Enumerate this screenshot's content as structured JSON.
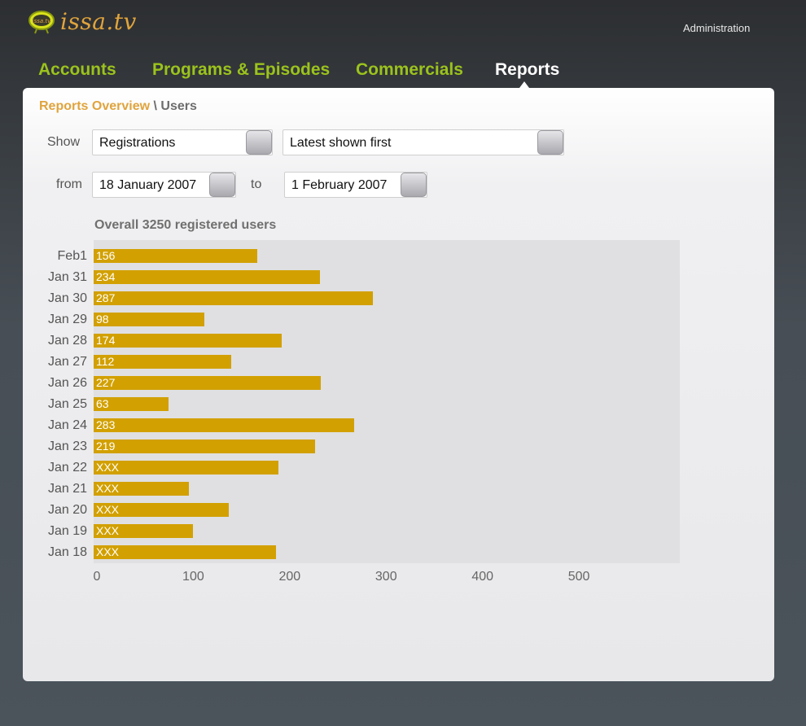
{
  "header": {
    "logo_badge": "issa.tv",
    "logo_text": "issa.tv",
    "admin_label": "Administration"
  },
  "nav": {
    "items": [
      {
        "label": "Accounts",
        "active": false
      },
      {
        "label": "Programs & Episodes",
        "active": false
      },
      {
        "label": "Commercials",
        "active": false
      },
      {
        "label": "Reports",
        "active": true
      }
    ]
  },
  "breadcrumb": {
    "parent": "Reports Overview",
    "separator": " \\ ",
    "current": "Users"
  },
  "filters": {
    "show_label": "Show",
    "type_value": "Registrations",
    "order_value": "Latest shown first",
    "from_label": "from",
    "from_value": "18 January 2007",
    "to_label": "to",
    "to_value": "1 February 2007"
  },
  "colors": {
    "nav": "#9bc31c",
    "accent": "#e0a43c",
    "bar": "#d2a000"
  },
  "chart_data": {
    "type": "bar",
    "orientation": "horizontal",
    "title": "Overall 3250 registered users",
    "categories": [
      "Feb1",
      "Jan 31",
      "Jan 30",
      "Jan 29",
      "Jan 28",
      "Jan 27",
      "Jan 26",
      "Jan 25",
      "Jan 24",
      "Jan 23",
      "Jan 22",
      "Jan 21",
      "Jan 20",
      "Jan 19",
      "Jan 18"
    ],
    "values": [
      170,
      235,
      290,
      115,
      195,
      143,
      236,
      78,
      270,
      230,
      192,
      99,
      140,
      103,
      189
    ],
    "data_labels": [
      "156",
      "234",
      "287",
      "98",
      "174",
      "112",
      "227",
      "63",
      "283",
      "219",
      "XXX",
      "XXX",
      "XXX",
      "XXX",
      "XXX"
    ],
    "xlim": [
      0,
      608
    ],
    "xticks": [
      0,
      100,
      200,
      300,
      400,
      500
    ],
    "grid": false,
    "legend": "none"
  }
}
